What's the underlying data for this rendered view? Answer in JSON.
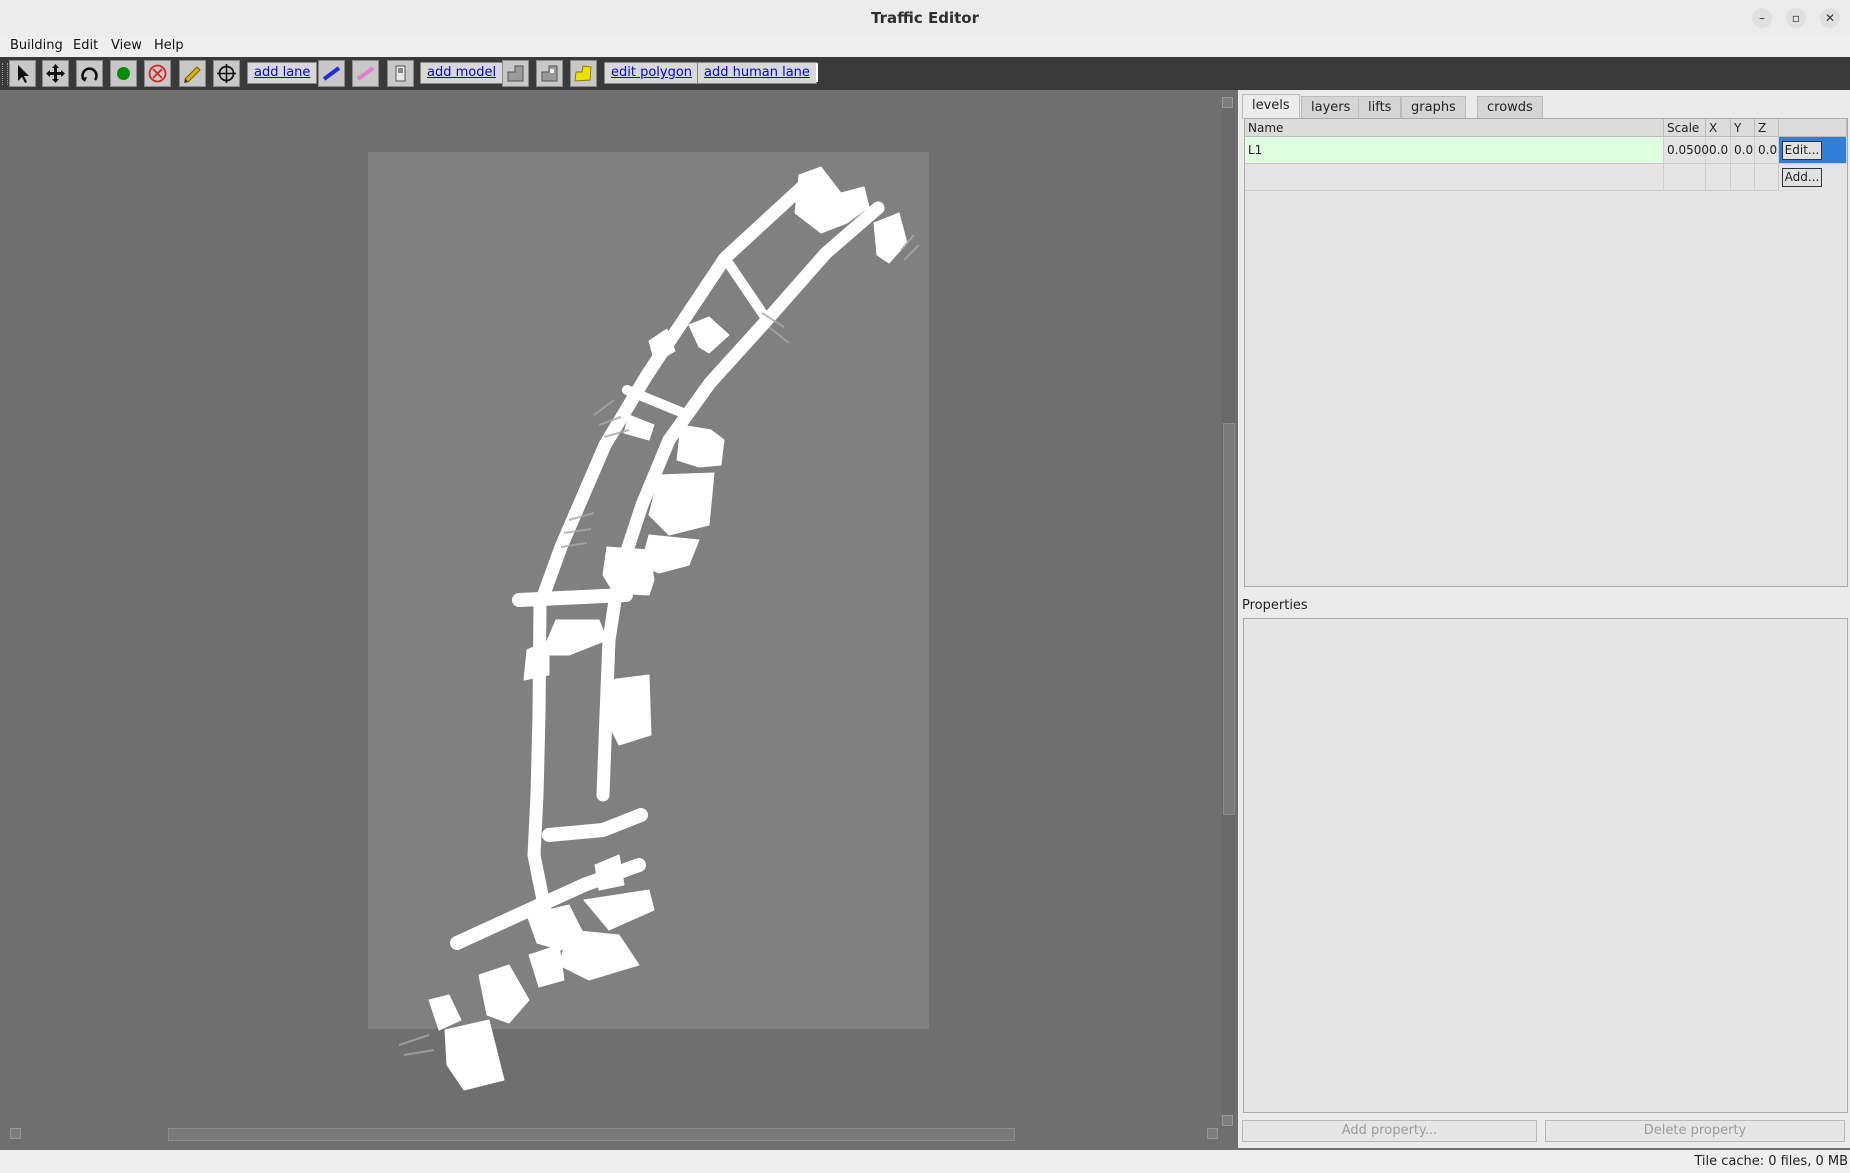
{
  "window": {
    "title": "Traffic Editor",
    "controls": [
      "minimize",
      "restore",
      "close"
    ]
  },
  "menubar": {
    "items": [
      "Building",
      "Edit",
      "View",
      "Help"
    ]
  },
  "toolbar": {
    "tools": [
      {
        "name": "select-tool",
        "icon": "arrow-pointer-icon"
      },
      {
        "name": "move-tool",
        "icon": "move-arrows-icon"
      },
      {
        "name": "rotate-tool",
        "icon": "rotate-icon"
      },
      {
        "name": "add-vertex-tool",
        "icon": "green-dot-icon"
      },
      {
        "name": "delete-tool",
        "icon": "delete-circle-icon"
      },
      {
        "name": "measure-tool",
        "icon": "measure-pencil-icon"
      },
      {
        "name": "add-fiducial-tool",
        "icon": "crosshair-icon"
      },
      {
        "name": "add-wall-tool",
        "icon": "wall-line-icon"
      },
      {
        "name": "add-measurement-tool",
        "icon": "pink-line-icon"
      },
      {
        "name": "add-door-tool",
        "icon": "door-icon"
      },
      {
        "name": "add-floor-tool",
        "icon": "floor-polygon-icon"
      },
      {
        "name": "add-hole-tool",
        "icon": "hole-polygon-icon"
      },
      {
        "name": "add-roi-tool",
        "icon": "yellow-polygon-icon"
      }
    ],
    "add_lane": "add lane",
    "add_model": "add model",
    "edit_polygon": "edit polygon",
    "add_human_lane": "add human lane",
    "colors": {
      "wall": "#1f2fd6",
      "measurement": "#e07fd0",
      "roi": "#f0e000",
      "vertex": "#0a8a0a",
      "delete": "#d22"
    }
  },
  "right_panel": {
    "tabs": [
      "levels",
      "layers",
      "lifts",
      "graphs",
      "crowds"
    ],
    "active_tab": "levels",
    "levels_table": {
      "columns": [
        "Name",
        "Scale",
        "X",
        "Y",
        "Z"
      ],
      "rows": [
        {
          "name": "L1",
          "scale": "0.0500",
          "x": "0.0",
          "y": "0.0",
          "z": "0.0",
          "action": "Edit..."
        }
      ],
      "add_label": "Add..."
    },
    "properties": {
      "label": "Properties",
      "add_property": "Add property...",
      "delete_property": "Delete property"
    }
  },
  "status_bar": {
    "text": "Tile cache: 0 files, 0 MB"
  }
}
